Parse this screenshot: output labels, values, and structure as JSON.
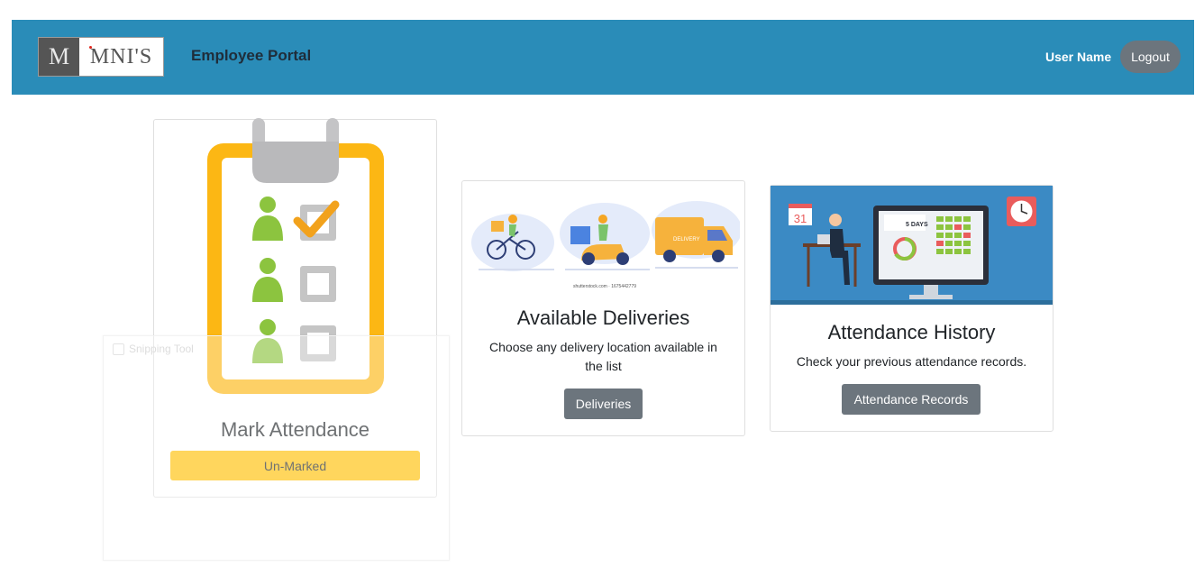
{
  "navbar": {
    "logo_left": "M",
    "logo_right": "MNI'S",
    "brand": "Employee Portal",
    "user_name": "User Name",
    "logout_label": "Logout",
    "color": "#2a8cb8"
  },
  "cards": {
    "attendance": {
      "title": "Mark Attendance",
      "status_label": "Un-Marked"
    },
    "deliveries": {
      "title": "Available Deliveries",
      "text": "Choose any delivery location available in the list",
      "button_label": "Deliveries",
      "image_caption": "shutterstock.com · 1675442779",
      "delivery_van_text": "DELIVERY"
    },
    "history": {
      "title": "Attendance History",
      "text": "Check your previous attendance records.",
      "button_label": "Attendance Records",
      "calendar_number": "31",
      "screen_label": "5 DAYS"
    }
  },
  "overlay": {
    "title": "Snipping Tool"
  }
}
